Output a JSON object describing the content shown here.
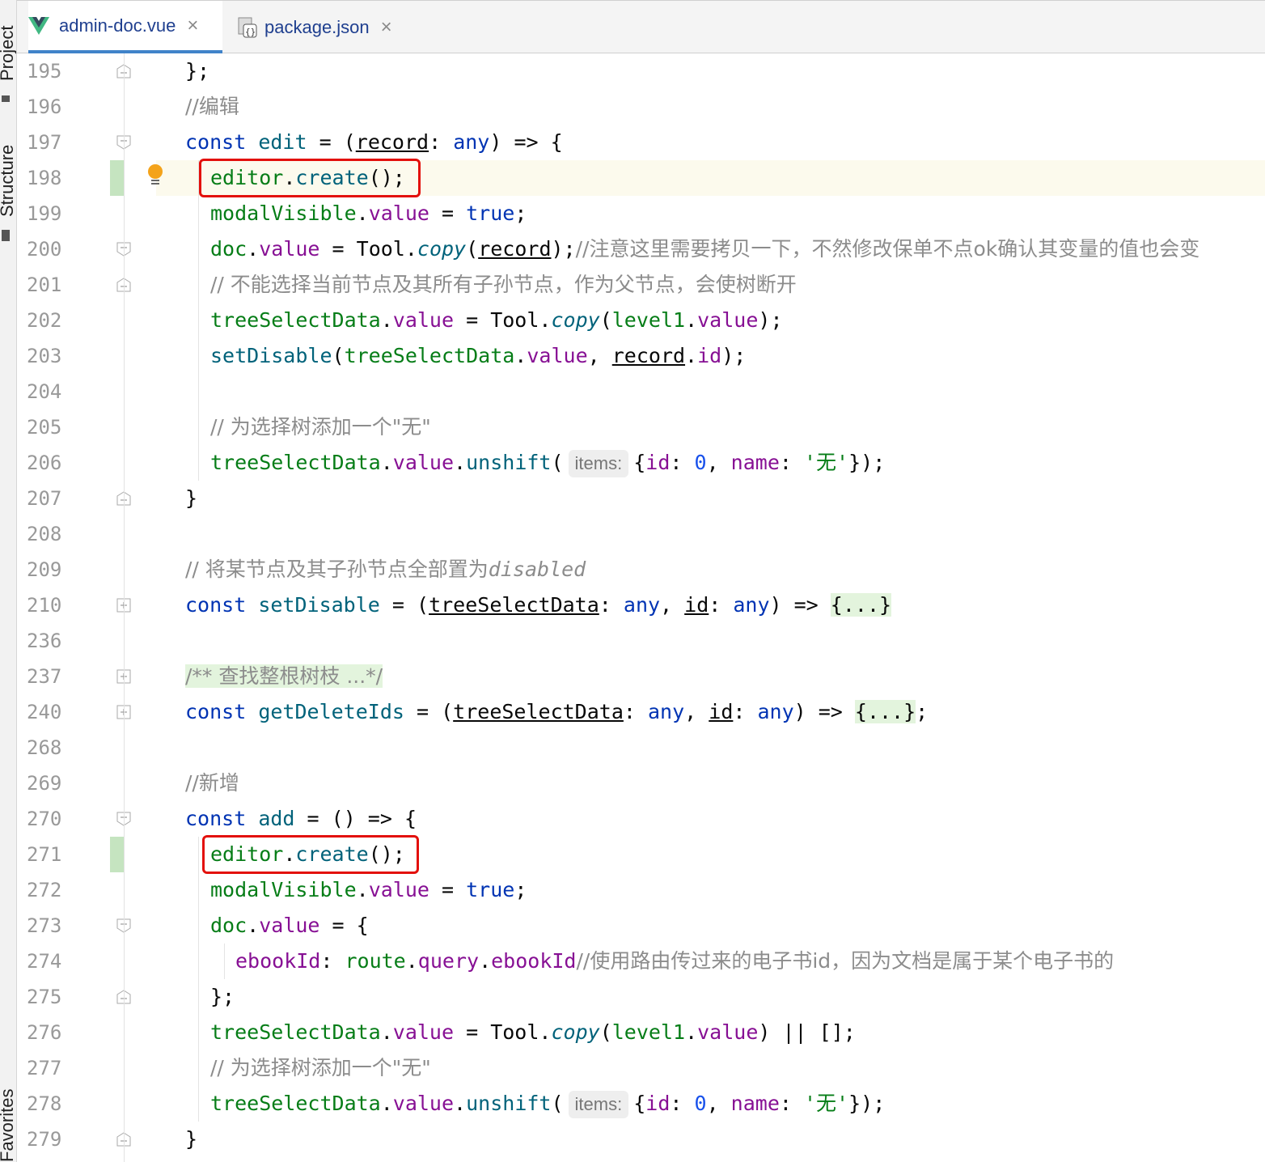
{
  "sidebar": {
    "project_label": "Project",
    "structure_label": "Structure",
    "favorites_label": "Favorites"
  },
  "tabs": [
    {
      "label": "admin-doc.vue",
      "icon": "vue-icon",
      "active": true
    },
    {
      "label": "package.json",
      "icon": "json-file-icon",
      "active": false
    }
  ],
  "close_glyph": "×",
  "inlay_hint": "items:",
  "line_numbers": [
    "195",
    "196",
    "197",
    "198",
    "199",
    "200",
    "201",
    "202",
    "203",
    "204",
    "205",
    "206",
    "207",
    "208",
    "209",
    "210",
    "236",
    "237",
    "240",
    "268",
    "269",
    "270",
    "271",
    "272",
    "273",
    "274",
    "275",
    "276",
    "277",
    "278",
    "279"
  ],
  "comments": {
    "edit": "//编辑",
    "copy_note": "//注意这里需要拷贝一下，不然修改保单不点ok确认其变量的值也会变",
    "cannot_select": "// 不能选择当前节点及其所有子孙节点，作为父节点，会使树断开",
    "add_none": "// 为选择树添加一个\"无\"",
    "disable_prefix": "// 将某节点及其子孙节点全部置为",
    "disable_word": "disabled",
    "javadoc": "/** 查找整根树枝 ...*/",
    "add": "//新增",
    "ebook_note": "//使用路由传过来的电子书id，因为文档是属于某个电子书的"
  },
  "colors": {
    "keyword": "#0033b3",
    "property": "#871094",
    "function": "#00627a",
    "string": "#067d17",
    "number": "#1750eb",
    "comment": "#8c8c8c",
    "highlight_box": "#e3100b",
    "current_line": "#fcfaed",
    "modified_marker": "#c5e4c0"
  }
}
